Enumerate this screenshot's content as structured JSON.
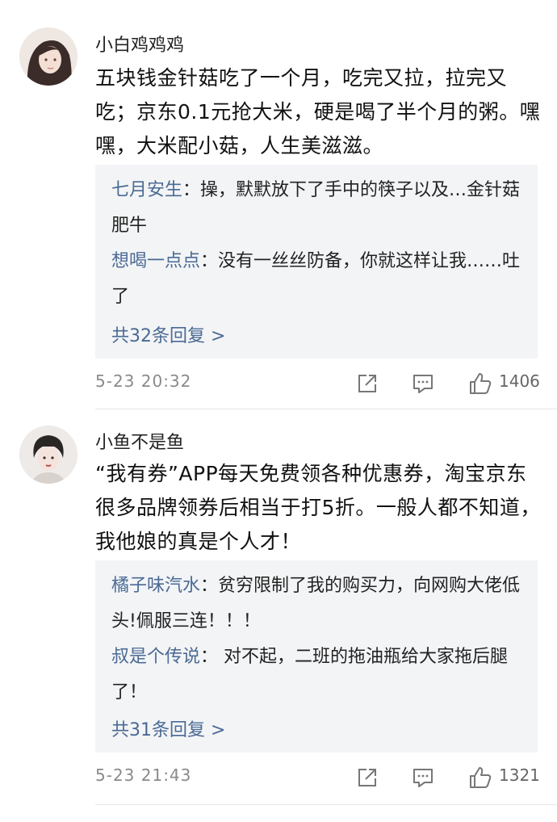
{
  "comments": [
    {
      "username": "小白鸡鸡鸡",
      "text": "五块钱金针菇吃了一个月，吃完又拉，拉完又吃；京东0.1元抢大米，硬是喝了半个月的粥。嘿嘿，大米配小菇，人生美滋滋。",
      "replies": [
        {
          "name": "七月安生",
          "text": "：操，默默放下了手中的筷子以及…金针菇肥牛"
        },
        {
          "name": "想喝一点点",
          "text": "：没有一丝丝防备，你就这样让我……吐了"
        }
      ],
      "more_label": "共32条回复 >",
      "date": "5-23  20:32",
      "likes": "1406"
    },
    {
      "username": "小鱼不是鱼",
      "text": "“我有券”APP每天免费领各种优惠券，淘宝京东很多品牌领券后相当于打5折。一般人都不知道，我他娘的真是个人才！",
      "replies": [
        {
          "name": "橘子味汽水",
          "text": "：贫穷限制了我的购买力，向网购大佬低头!佩服三连！！！"
        },
        {
          "name": "叔是个传说",
          "text": "：  对不起，二班的拖油瓶给大家拖后腿了！"
        }
      ],
      "more_label": "共31条回复 >",
      "date": "5-23  21:43",
      "likes": "1321"
    }
  ]
}
